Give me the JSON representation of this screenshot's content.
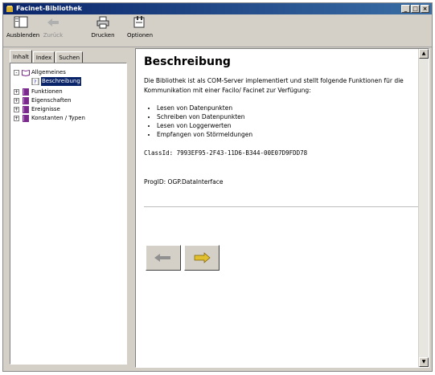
{
  "window": {
    "title": "Facinet-Bibliothek",
    "controls": [
      "minimize-icon",
      "maximize-icon",
      "close-icon"
    ]
  },
  "toolbar": {
    "buttons": [
      {
        "label": "Ausblenden",
        "icon": "hide-panel-icon",
        "enabled": true
      },
      {
        "label": "Zurück",
        "icon": "back-arrow-icon",
        "enabled": false
      },
      {
        "label": "Drucken",
        "icon": "printer-icon",
        "enabled": true
      },
      {
        "label": "Optionen",
        "icon": "options-icon",
        "enabled": true
      }
    ]
  },
  "nav": {
    "tabs": [
      {
        "label": "Inhalt"
      },
      {
        "label": "Index"
      },
      {
        "label": "Suchen"
      }
    ],
    "tree": [
      {
        "label": "Allgemeines",
        "icon": "open-book-icon",
        "expanded": true
      },
      {
        "label": "Beschreibung",
        "icon": "help-page-icon",
        "selected": true
      },
      {
        "label": "Funktionen",
        "icon": "book-icon"
      },
      {
        "label": "Eigenschaften",
        "icon": "book-icon"
      },
      {
        "label": "Ereignisse",
        "icon": "book-icon"
      },
      {
        "label": "Konstanten / Typen",
        "icon": "book-icon"
      }
    ]
  },
  "content": {
    "title": "Beschreibung",
    "intro": "Die Bibliothek ist als COM-Server implementiert und stellt folgende Funktionen für die Kommunikation mit einer Facilo/ Facinet zur Verfügung:",
    "bullets": [
      "Lesen von Datenpunkten",
      "Schreiben von Datenpunkten",
      "Lesen von Loggerwerten",
      "Empfangen von Störmeldungen"
    ],
    "class_id": "ClassId: 7993EF95-2F43-11D6-B344-00E07D9FDD78",
    "prog_id": "ProgID: OGP.DataInterface"
  },
  "nav_buttons": [
    {
      "icon": "previous-page-icon"
    },
    {
      "icon": "next-page-icon"
    }
  ]
}
